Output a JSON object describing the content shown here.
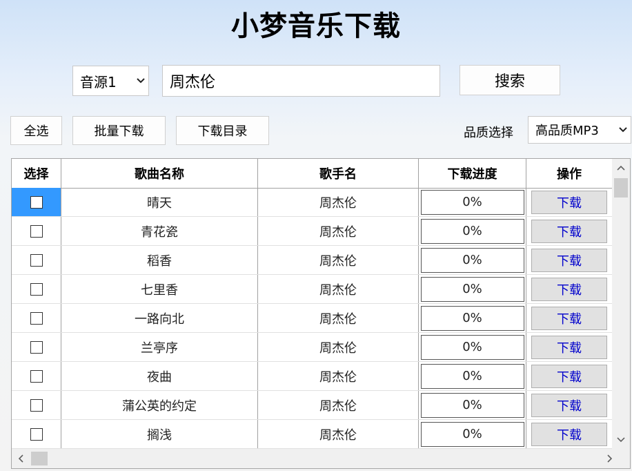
{
  "app": {
    "title": "小梦音乐下载"
  },
  "search": {
    "source_selected": "音源1",
    "query_value": "周杰伦",
    "search_label": "搜索"
  },
  "toolbar": {
    "select_all_label": "全选",
    "batch_download_label": "批量下载",
    "download_dir_label": "下载目录",
    "quality_label": "品质选择",
    "quality_selected": "高品质MP3"
  },
  "table": {
    "headers": [
      "选择",
      "歌曲名称",
      "歌手名",
      "下载进度",
      "操作"
    ],
    "rows": [
      {
        "song": "晴天",
        "artist": "周杰伦",
        "progress": "0%",
        "action": "下载"
      },
      {
        "song": "青花瓷",
        "artist": "周杰伦",
        "progress": "0%",
        "action": "下载"
      },
      {
        "song": "稻香",
        "artist": "周杰伦",
        "progress": "0%",
        "action": "下载"
      },
      {
        "song": "七里香",
        "artist": "周杰伦",
        "progress": "0%",
        "action": "下载"
      },
      {
        "song": "一路向北",
        "artist": "周杰伦",
        "progress": "0%",
        "action": "下载"
      },
      {
        "song": "兰亭序",
        "artist": "周杰伦",
        "progress": "0%",
        "action": "下载"
      },
      {
        "song": "夜曲",
        "artist": "周杰伦",
        "progress": "0%",
        "action": "下载"
      },
      {
        "song": "蒲公英的约定",
        "artist": "周杰伦",
        "progress": "0%",
        "action": "下载"
      },
      {
        "song": "搁浅",
        "artist": "周杰伦",
        "progress": "0%",
        "action": "下载"
      }
    ]
  },
  "icons": {
    "dropdown": "chevron-down-icon",
    "scroll_up": "chevron-up-icon",
    "scroll_down": "chevron-down-icon",
    "scroll_left": "chevron-left-icon",
    "scroll_right": "chevron-right-icon"
  },
  "colors": {
    "selected_cell": "#3399ff",
    "download_link": "#0000cc"
  }
}
